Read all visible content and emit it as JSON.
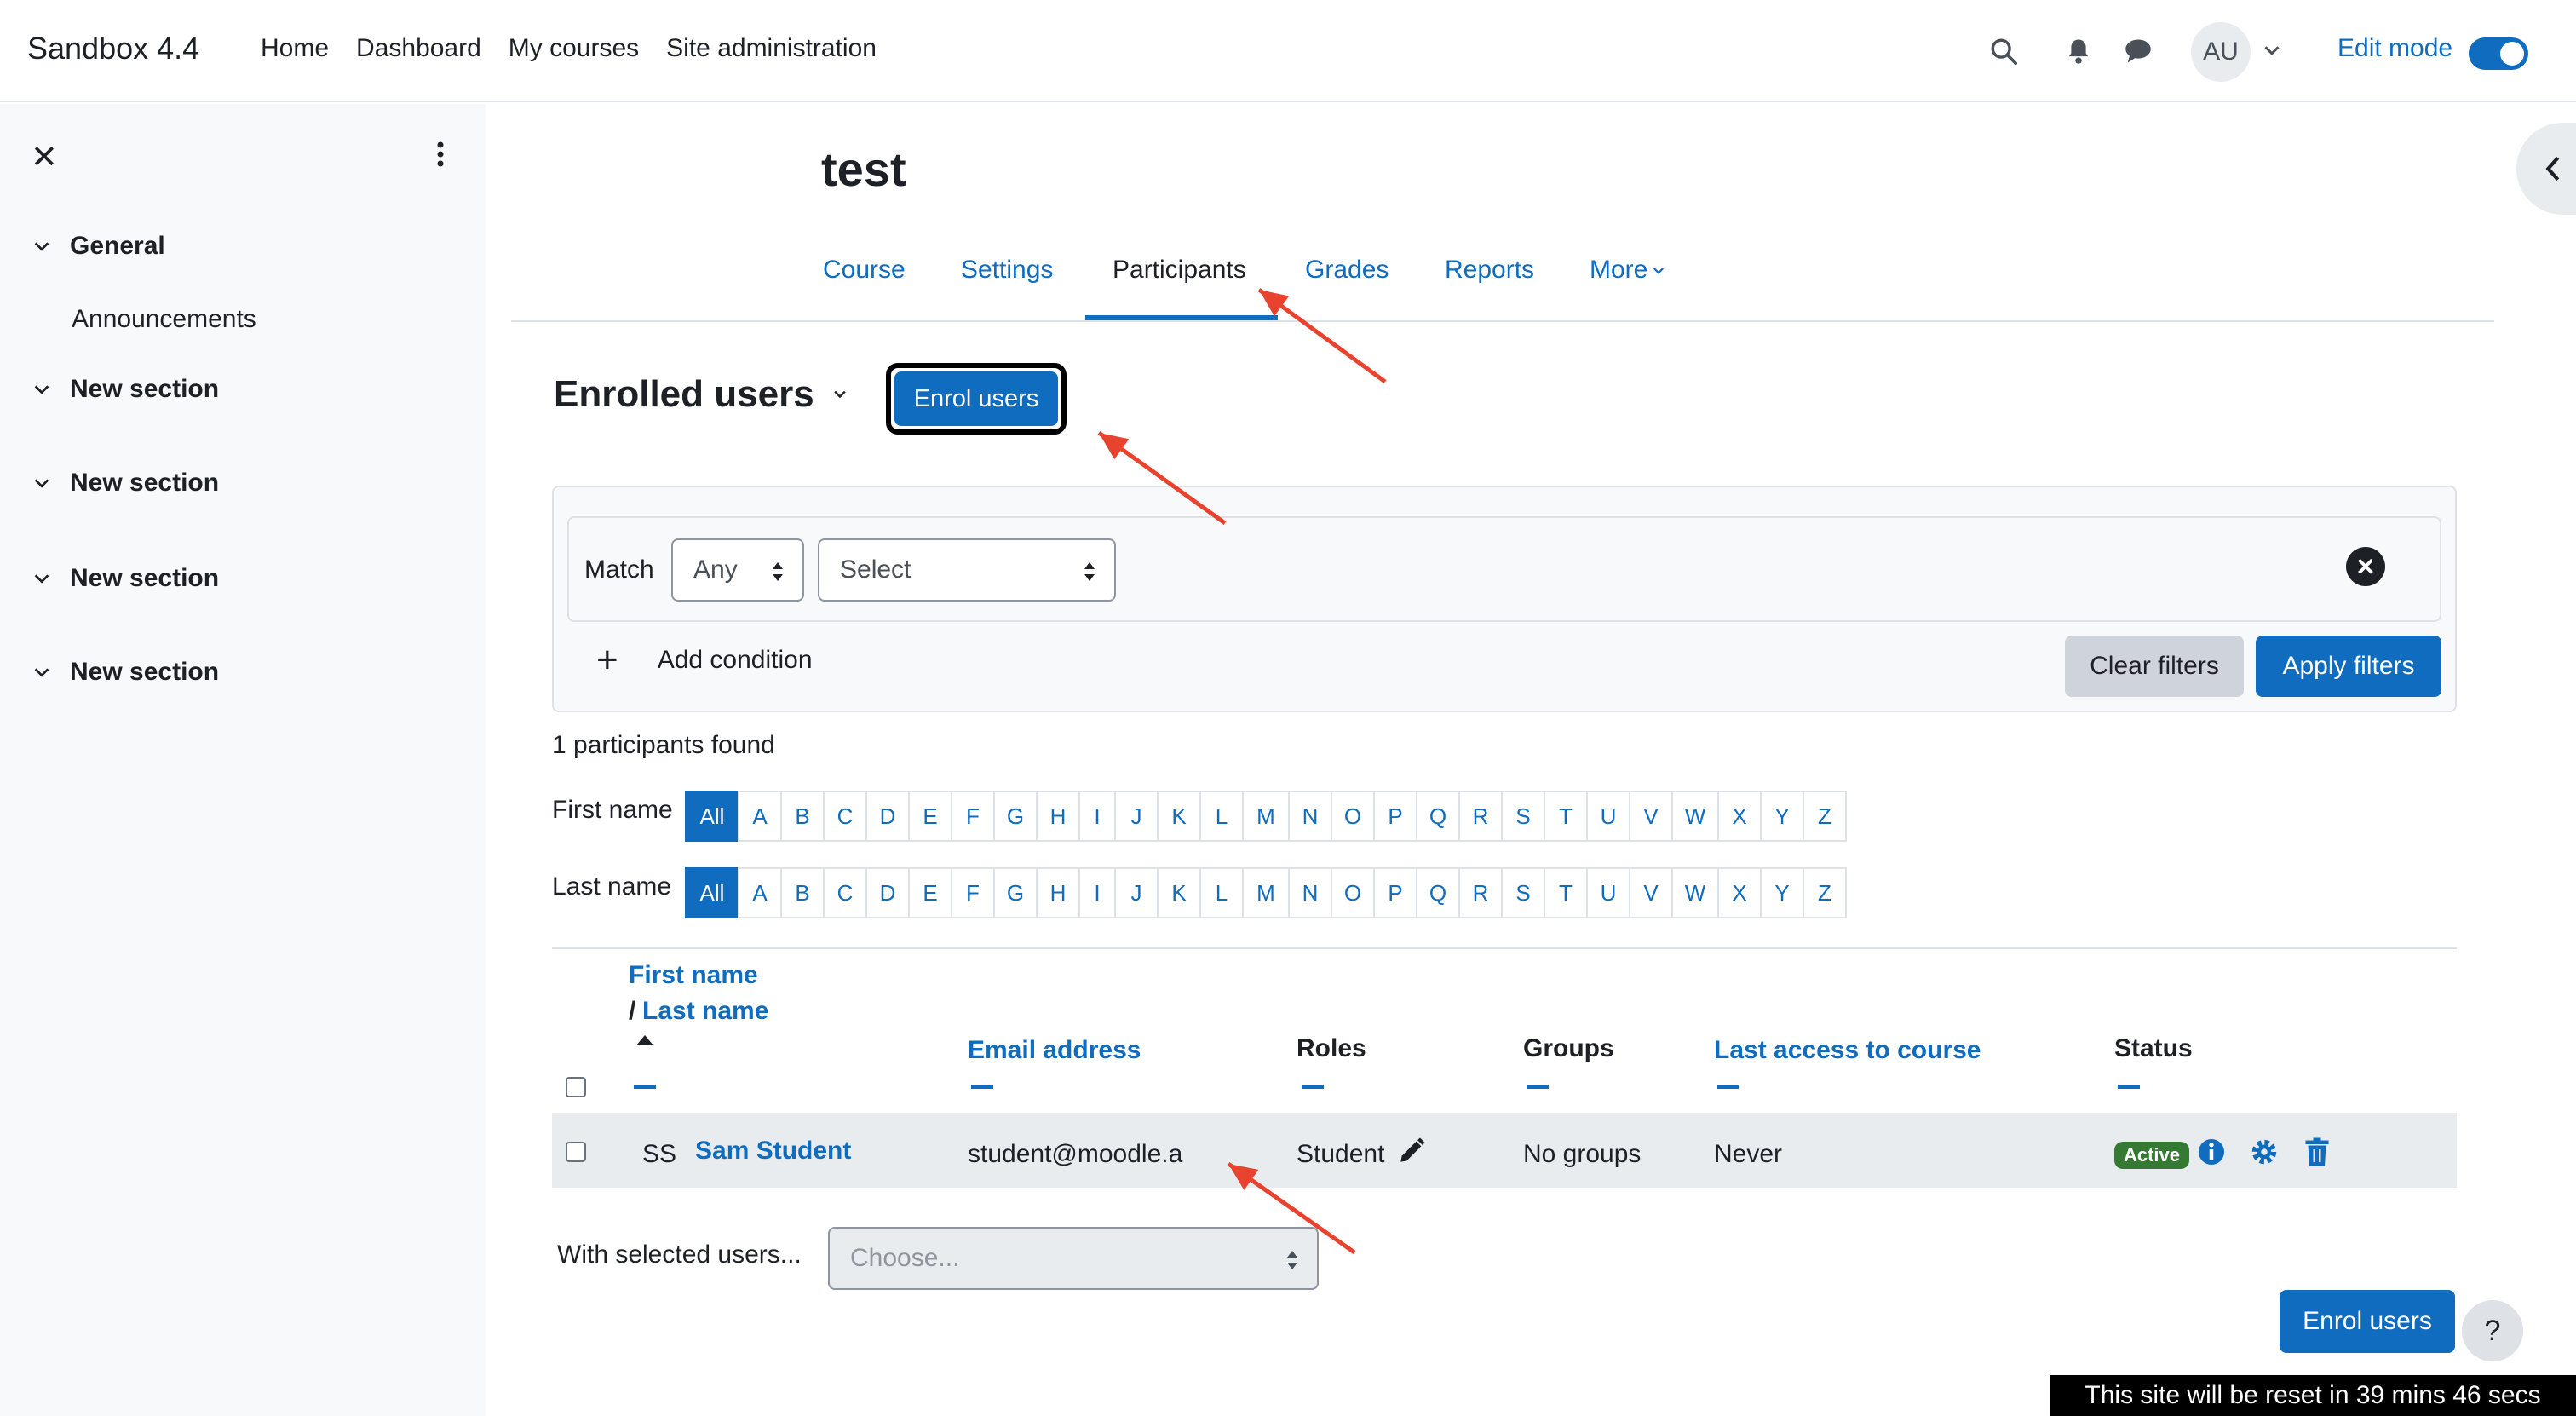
{
  "navbar": {
    "brand": "Sandbox 4.4",
    "links": [
      "Home",
      "Dashboard",
      "My courses",
      "Site administration"
    ],
    "icons": [
      "search-icon",
      "bell-icon",
      "chat-icon"
    ],
    "avatar_initials": "AU",
    "edit_mode_label": "Edit mode",
    "edit_mode_on": true
  },
  "drawer": {
    "sections": [
      {
        "label": "General",
        "items": [
          "Announcements"
        ]
      },
      {
        "label": "New section",
        "items": []
      },
      {
        "label": "New section",
        "items": []
      },
      {
        "label": "New section",
        "items": []
      },
      {
        "label": "New section",
        "items": []
      }
    ]
  },
  "course": {
    "title": "test",
    "tabs": [
      "Course",
      "Settings",
      "Participants",
      "Grades",
      "Reports",
      "More"
    ],
    "active_tab": "Participants"
  },
  "participants": {
    "heading": "Enrolled users",
    "enrol_button": "Enrol users",
    "filter": {
      "match_label": "Match",
      "match_value": "Any",
      "select_value": "Select",
      "add_condition": "Add condition",
      "clear_button": "Clear filters",
      "apply_button": "Apply filters"
    },
    "found_text": "1 participants found",
    "first_name_label": "First name",
    "last_name_label": "Last name",
    "initials": [
      "All",
      "A",
      "B",
      "C",
      "D",
      "E",
      "F",
      "G",
      "H",
      "I",
      "J",
      "K",
      "L",
      "M",
      "N",
      "O",
      "P",
      "Q",
      "R",
      "S",
      "T",
      "U",
      "V",
      "W",
      "X",
      "Y",
      "Z"
    ],
    "columns": {
      "first_name": "First name",
      "slash": "/",
      "last_name": "Last name",
      "email": "Email address",
      "roles": "Roles",
      "groups": "Groups",
      "last_access": "Last access to course",
      "status": "Status"
    },
    "rows": [
      {
        "initials": "SS",
        "name": "Sam Student",
        "email": "student@moodle.a",
        "role": "Student",
        "groups": "No groups",
        "last_access": "Never",
        "status": "Active"
      }
    ],
    "with_selected_label": "With selected users...",
    "with_selected_placeholder": "Choose...",
    "enrol_button_bottom": "Enrol users"
  },
  "help_label": "?",
  "reset_notice": "This site will be reset in 39 mins 46 secs",
  "colors": {
    "primary": "#0f6cbf",
    "active_badge": "#357a32",
    "annotation_arrow": "#e8432e"
  }
}
